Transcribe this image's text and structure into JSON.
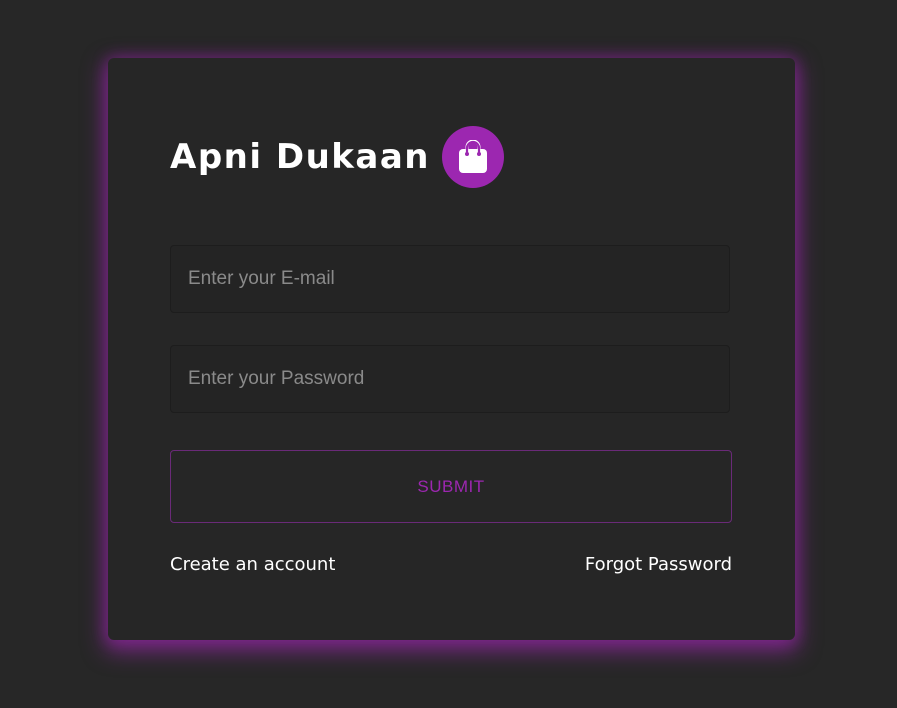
{
  "brand": {
    "title": "Apni Dukaan",
    "logo_icon": "shopping-bag-icon",
    "logo_color": "#9c27b0"
  },
  "form": {
    "email_placeholder": "Enter your E-mail",
    "email_value": "",
    "password_placeholder": "Enter your Password",
    "password_value": "",
    "submit_label": "SUBMIT"
  },
  "links": {
    "create_account": "Create an account",
    "forgot_password": "Forgot Password"
  },
  "colors": {
    "background": "#272727",
    "card": "#262626",
    "accent": "#9c27b0"
  }
}
